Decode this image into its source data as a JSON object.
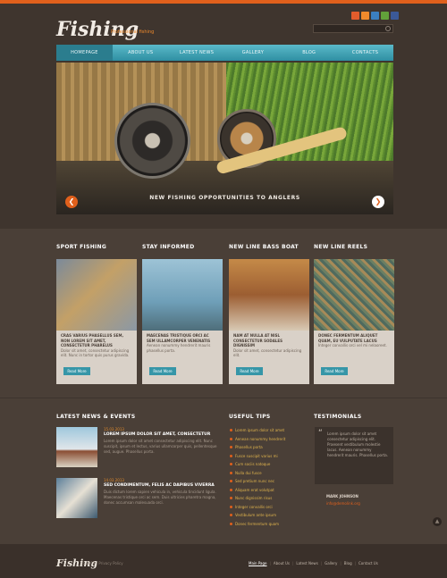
{
  "header": {
    "logo": "Fishing",
    "tagline": "Professional fishing",
    "social": [
      {
        "icon": "dribbble-icon",
        "color": "#e25c2c"
      },
      {
        "icon": "rss-icon",
        "color": "#f08a2c"
      },
      {
        "icon": "delicious-icon",
        "color": "#3b7fc0"
      },
      {
        "icon": "plus-icon",
        "color": "#62a23a"
      },
      {
        "icon": "facebook-icon",
        "color": "#3b5998"
      }
    ]
  },
  "nav": {
    "items": [
      "HOMEPAGE",
      "ABOUT US",
      "LATEST NEWS",
      "GALLERY",
      "BLOG",
      "CONTACTS"
    ]
  },
  "slider": {
    "caption": "NEW FISHING OPPORTUNITIES TO ANGLERS"
  },
  "features": [
    {
      "title": "SPORT FISHING",
      "lead": "CRAS VARIUS PHASELLUS SEM, NON LOREM SIT AMET, CONSECTETUR PHARELUS",
      "body": "Dolor sit amet, consectetur adipiscing elit. Nunc in tortor quis purus gravida.",
      "button": "Read More"
    },
    {
      "title": "STAY INFORMED",
      "lead": "MAECENAS TRISTIQUE ORCI AC SEM ULLAMCORPER VENENATIS",
      "body": "Aenean nonummy hendrerit mauris phasellus porta.",
      "button": "Read More"
    },
    {
      "title": "NEW LINE BASS BOAT",
      "lead": "NAM AT NULLA AT NISL CONSECTETUR SODALES DIGNISSIM",
      "body": "Dolor sit amet, consectetur adipiscing elit.",
      "button": "Read More"
    },
    {
      "title": "NEW LINE REELS",
      "lead": "DONEC FERMENTUM ALIQUET QUAM, EU VULPUTATE LACUS",
      "body": "Integer convallis orci vel mi nelaoreet.",
      "button": "Read More"
    }
  ],
  "news": {
    "title": "LATEST NEWS & EVENTS",
    "items": [
      {
        "date": "15.03.2013",
        "title": "LOREM IPSUM DOLOR SIT AMET, CONSECTETUR",
        "body": "Lorem ipsum dolor sit amet consectetur adipiscing elit. Nunc suscipit, ipsum et lectus, varius ullamcorper quis, pellentesque sed, augue. Phasellus porta."
      },
      {
        "date": "14.03.2013",
        "title": "SED CONDIMENTUM, FELIS AC DAPIBUS VIVERRA",
        "body": "Duis dictum lorem sapien vehicula in, vehicula tincidunt ligula. Maecenas tristique orci ac sem. Duis ultricies pharetra magna, donec accumsan malesuada orci."
      }
    ]
  },
  "tips": {
    "title": "USEFUL TIPS",
    "items": [
      "Lorem ipsum dolor sit amet",
      "Aenean nonummy hendrerit",
      "Phasellus porta",
      "Fusce suscipit varius mi",
      "Cum sociis natoque",
      "Nulla dui fusce",
      "Sed pretium nunc nec",
      "Aliquam erat volutpat",
      "Nunc dignissim risus",
      "Integer convallis orci",
      "Vestibulum ante ipsum",
      "Donec fermentum quam"
    ]
  },
  "testimonials": {
    "title": "TESTIMONIALS",
    "quote": "Lorem ipsum dolor sit amet consectetur adipiscing elit. Praesent vestibulum molestie lacus. Aenean nonummy hendrerit mauris. Phasellus porta.",
    "author": "MARK JOHNSON",
    "link": "info@demolink.org"
  },
  "footer": {
    "logo": "Fishing",
    "copyright": "© 2013 | Privacy Policy",
    "nav": [
      "Main Page",
      "About Us",
      "Latest News",
      "Gallery",
      "Blog",
      "Contact Us"
    ]
  }
}
